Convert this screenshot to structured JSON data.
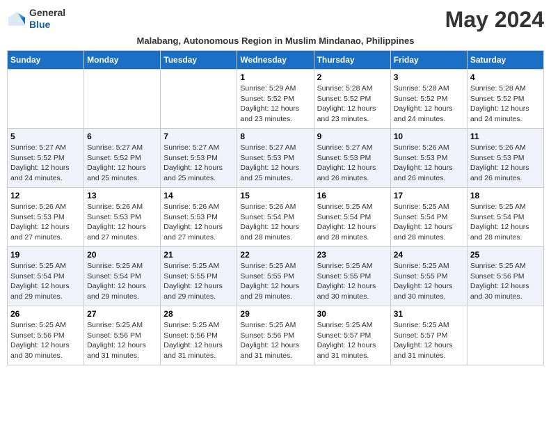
{
  "app": {
    "logo_line1": "General",
    "logo_line2": "Blue",
    "month_title": "May 2024",
    "subtitle": "Malabang, Autonomous Region in Muslim Mindanao, Philippines"
  },
  "calendar": {
    "headers": [
      "Sunday",
      "Monday",
      "Tuesday",
      "Wednesday",
      "Thursday",
      "Friday",
      "Saturday"
    ],
    "weeks": [
      [
        {
          "day": "",
          "info": ""
        },
        {
          "day": "",
          "info": ""
        },
        {
          "day": "",
          "info": ""
        },
        {
          "day": "1",
          "info": "Sunrise: 5:29 AM\nSunset: 5:52 PM\nDaylight: 12 hours\nand 23 minutes."
        },
        {
          "day": "2",
          "info": "Sunrise: 5:28 AM\nSunset: 5:52 PM\nDaylight: 12 hours\nand 23 minutes."
        },
        {
          "day": "3",
          "info": "Sunrise: 5:28 AM\nSunset: 5:52 PM\nDaylight: 12 hours\nand 24 minutes."
        },
        {
          "day": "4",
          "info": "Sunrise: 5:28 AM\nSunset: 5:52 PM\nDaylight: 12 hours\nand 24 minutes."
        }
      ],
      [
        {
          "day": "5",
          "info": "Sunrise: 5:27 AM\nSunset: 5:52 PM\nDaylight: 12 hours\nand 24 minutes."
        },
        {
          "day": "6",
          "info": "Sunrise: 5:27 AM\nSunset: 5:52 PM\nDaylight: 12 hours\nand 25 minutes."
        },
        {
          "day": "7",
          "info": "Sunrise: 5:27 AM\nSunset: 5:53 PM\nDaylight: 12 hours\nand 25 minutes."
        },
        {
          "day": "8",
          "info": "Sunrise: 5:27 AM\nSunset: 5:53 PM\nDaylight: 12 hours\nand 25 minutes."
        },
        {
          "day": "9",
          "info": "Sunrise: 5:27 AM\nSunset: 5:53 PM\nDaylight: 12 hours\nand 26 minutes."
        },
        {
          "day": "10",
          "info": "Sunrise: 5:26 AM\nSunset: 5:53 PM\nDaylight: 12 hours\nand 26 minutes."
        },
        {
          "day": "11",
          "info": "Sunrise: 5:26 AM\nSunset: 5:53 PM\nDaylight: 12 hours\nand 26 minutes."
        }
      ],
      [
        {
          "day": "12",
          "info": "Sunrise: 5:26 AM\nSunset: 5:53 PM\nDaylight: 12 hours\nand 27 minutes."
        },
        {
          "day": "13",
          "info": "Sunrise: 5:26 AM\nSunset: 5:53 PM\nDaylight: 12 hours\nand 27 minutes."
        },
        {
          "day": "14",
          "info": "Sunrise: 5:26 AM\nSunset: 5:53 PM\nDaylight: 12 hours\nand 27 minutes."
        },
        {
          "day": "15",
          "info": "Sunrise: 5:26 AM\nSunset: 5:54 PM\nDaylight: 12 hours\nand 28 minutes."
        },
        {
          "day": "16",
          "info": "Sunrise: 5:25 AM\nSunset: 5:54 PM\nDaylight: 12 hours\nand 28 minutes."
        },
        {
          "day": "17",
          "info": "Sunrise: 5:25 AM\nSunset: 5:54 PM\nDaylight: 12 hours\nand 28 minutes."
        },
        {
          "day": "18",
          "info": "Sunrise: 5:25 AM\nSunset: 5:54 PM\nDaylight: 12 hours\nand 28 minutes."
        }
      ],
      [
        {
          "day": "19",
          "info": "Sunrise: 5:25 AM\nSunset: 5:54 PM\nDaylight: 12 hours\nand 29 minutes."
        },
        {
          "day": "20",
          "info": "Sunrise: 5:25 AM\nSunset: 5:54 PM\nDaylight: 12 hours\nand 29 minutes."
        },
        {
          "day": "21",
          "info": "Sunrise: 5:25 AM\nSunset: 5:55 PM\nDaylight: 12 hours\nand 29 minutes."
        },
        {
          "day": "22",
          "info": "Sunrise: 5:25 AM\nSunset: 5:55 PM\nDaylight: 12 hours\nand 29 minutes."
        },
        {
          "day": "23",
          "info": "Sunrise: 5:25 AM\nSunset: 5:55 PM\nDaylight: 12 hours\nand 30 minutes."
        },
        {
          "day": "24",
          "info": "Sunrise: 5:25 AM\nSunset: 5:55 PM\nDaylight: 12 hours\nand 30 minutes."
        },
        {
          "day": "25",
          "info": "Sunrise: 5:25 AM\nSunset: 5:56 PM\nDaylight: 12 hours\nand 30 minutes."
        }
      ],
      [
        {
          "day": "26",
          "info": "Sunrise: 5:25 AM\nSunset: 5:56 PM\nDaylight: 12 hours\nand 30 minutes."
        },
        {
          "day": "27",
          "info": "Sunrise: 5:25 AM\nSunset: 5:56 PM\nDaylight: 12 hours\nand 31 minutes."
        },
        {
          "day": "28",
          "info": "Sunrise: 5:25 AM\nSunset: 5:56 PM\nDaylight: 12 hours\nand 31 minutes."
        },
        {
          "day": "29",
          "info": "Sunrise: 5:25 AM\nSunset: 5:56 PM\nDaylight: 12 hours\nand 31 minutes."
        },
        {
          "day": "30",
          "info": "Sunrise: 5:25 AM\nSunset: 5:57 PM\nDaylight: 12 hours\nand 31 minutes."
        },
        {
          "day": "31",
          "info": "Sunrise: 5:25 AM\nSunset: 5:57 PM\nDaylight: 12 hours\nand 31 minutes."
        },
        {
          "day": "",
          "info": ""
        }
      ]
    ]
  }
}
